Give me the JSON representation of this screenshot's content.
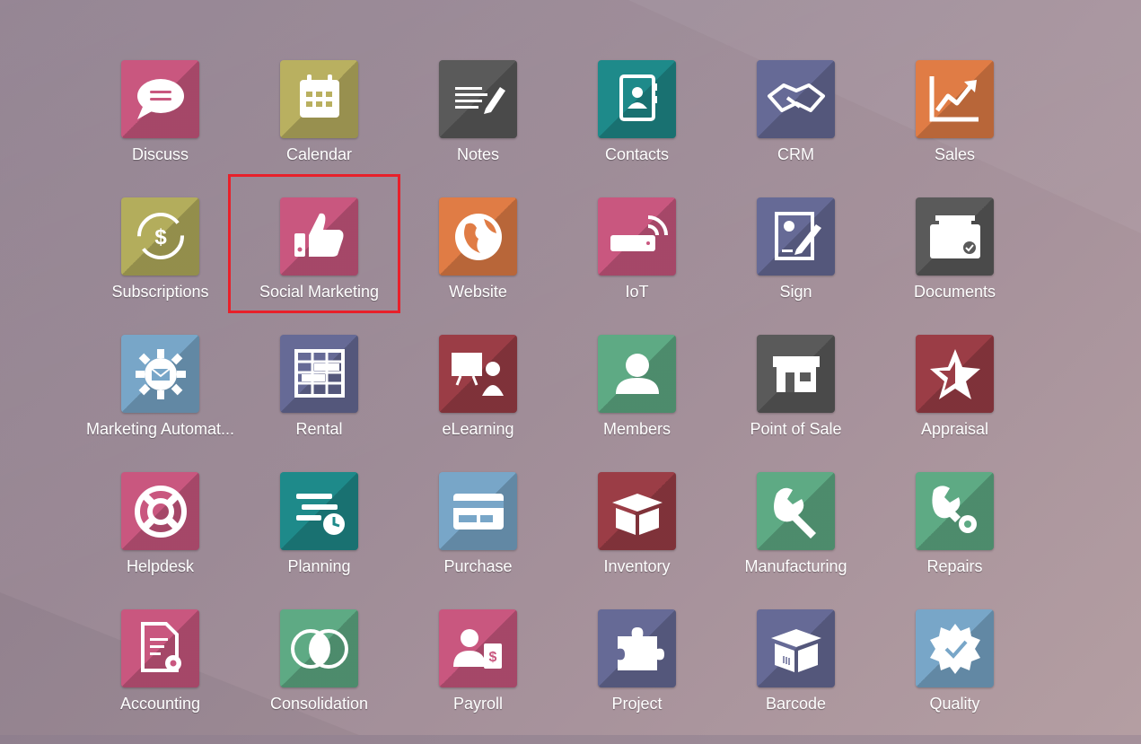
{
  "apps": [
    {
      "label": "Discuss",
      "icon": "chat-bubble-icon",
      "color": "#c9577f"
    },
    {
      "label": "Calendar",
      "icon": "calendar-icon",
      "color": "#b9b060"
    },
    {
      "label": "Notes",
      "icon": "notes-icon",
      "color": "#5a5a5a"
    },
    {
      "label": "Contacts",
      "icon": "contacts-book-icon",
      "color": "#1e8a8a"
    },
    {
      "label": "CRM",
      "icon": "handshake-icon",
      "color": "#666a96"
    },
    {
      "label": "Sales",
      "icon": "chart-up-icon",
      "color": "#e07c45"
    },
    {
      "label": "Subscriptions",
      "icon": "recurring-dollar-icon",
      "color": "#b3ad5c"
    },
    {
      "label": "Social Marketing",
      "icon": "thumbs-up-icon",
      "color": "#c9577f"
    },
    {
      "label": "Website",
      "icon": "globe-icon",
      "color": "#e07c45"
    },
    {
      "label": "IoT",
      "icon": "iot-device-icon",
      "color": "#c9577f"
    },
    {
      "label": "Sign",
      "icon": "sign-document-icon",
      "color": "#666a96"
    },
    {
      "label": "Documents",
      "icon": "inbox-tray-icon",
      "color": "#5a5a5a"
    },
    {
      "label": "Marketing Automat...",
      "icon": "gear-mail-icon",
      "color": "#78a6c8"
    },
    {
      "label": "Rental",
      "icon": "rental-board-icon",
      "color": "#666a96"
    },
    {
      "label": "eLearning",
      "icon": "teacher-board-icon",
      "color": "#9b3d46"
    },
    {
      "label": "Members",
      "icon": "person-icon",
      "color": "#5eaa84"
    },
    {
      "label": "Point of Sale",
      "icon": "shop-icon",
      "color": "#5a5a5a"
    },
    {
      "label": "Appraisal",
      "icon": "star-icon",
      "color": "#9b3d46"
    },
    {
      "label": "Helpdesk",
      "icon": "lifebuoy-icon",
      "color": "#c9577f"
    },
    {
      "label": "Planning",
      "icon": "planning-clock-icon",
      "color": "#1e8a8a"
    },
    {
      "label": "Purchase",
      "icon": "credit-card-icon",
      "color": "#78a6c8"
    },
    {
      "label": "Inventory",
      "icon": "open-box-icon",
      "color": "#9b3d46"
    },
    {
      "label": "Manufacturing",
      "icon": "wrench-icon",
      "color": "#5eaa84"
    },
    {
      "label": "Repairs",
      "icon": "wrench-gear-icon",
      "color": "#5eaa84"
    },
    {
      "label": "Accounting",
      "icon": "document-gear-icon",
      "color": "#c9577f"
    },
    {
      "label": "Consolidation",
      "icon": "overlap-circles-icon",
      "color": "#5eaa84"
    },
    {
      "label": "Payroll",
      "icon": "person-dollar-icon",
      "color": "#c9577f"
    },
    {
      "label": "Project",
      "icon": "puzzle-icon",
      "color": "#666a96"
    },
    {
      "label": "Barcode",
      "icon": "barcode-box-icon",
      "color": "#666a96"
    },
    {
      "label": "Quality",
      "icon": "quality-badge-icon",
      "color": "#78a6c8"
    }
  ],
  "highlight_color": "#e8202a"
}
